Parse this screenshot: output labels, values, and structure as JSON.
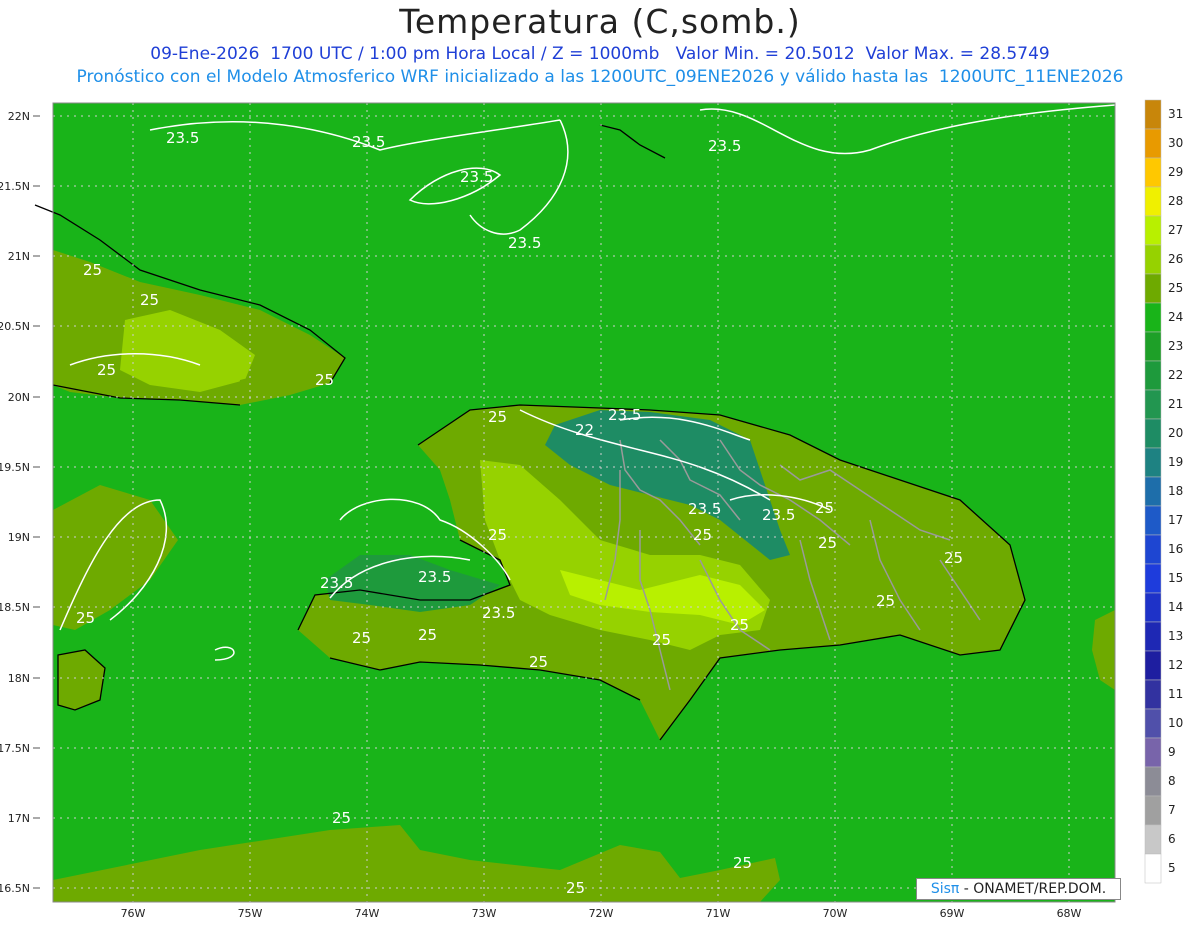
{
  "header": {
    "title": "Temperatura (C,somb.)",
    "line1": "09-Ene-2026  1700 UTC / 1:00 pm Hora Local / Z = 1000mb   Valor Min. = 20.5012  Valor Max. = 28.5749",
    "line2": "Pronóstico con el Modelo Atmosferico WRF inicializado a las 1200UTC_09ENE2026 y válido hasta las  1200UTC_11ENE2026"
  },
  "axes": {
    "lat_labels": [
      "22N",
      "21.5N",
      "21N",
      "20.5N",
      "20N",
      "19.5N",
      "19N",
      "18.5N",
      "18N",
      "17.5N",
      "17N",
      "16.5N"
    ],
    "lon_labels": [
      "76W",
      "75W",
      "74W",
      "73W",
      "72W",
      "71W",
      "70W",
      "69W",
      "68W"
    ]
  },
  "contour_labels": [
    "23.5",
    "25",
    "22"
  ],
  "colorbar": {
    "levels": [
      "31",
      "30",
      "29",
      "28",
      "27",
      "26",
      "25",
      "24",
      "23",
      "22",
      "21",
      "20",
      "19",
      "18",
      "17",
      "16",
      "15",
      "14",
      "13",
      "12",
      "11",
      "10",
      "9",
      "8",
      "7",
      "6",
      "5"
    ],
    "colors": [
      "#c8860a",
      "#e89a00",
      "#ffc800",
      "#f0f000",
      "#b8f000",
      "#96d200",
      "#6eaa00",
      "#19b419",
      "#1ea028",
      "#1e9a3c",
      "#229650",
      "#1e8c64",
      "#1e8282",
      "#1e6eaa",
      "#1e5ac8",
      "#1e46d2",
      "#1e3cdc",
      "#1e32c8",
      "#1e28b4",
      "#1e1ea0",
      "#3232a0",
      "#5050aa",
      "#7864aa",
      "#8c8c96",
      "#a0a0a0",
      "#c8c8c8",
      "#ffffff"
    ]
  },
  "credit": {
    "sis": "Sisπ",
    "rest": " - ONAMET/REP.DOM."
  }
}
